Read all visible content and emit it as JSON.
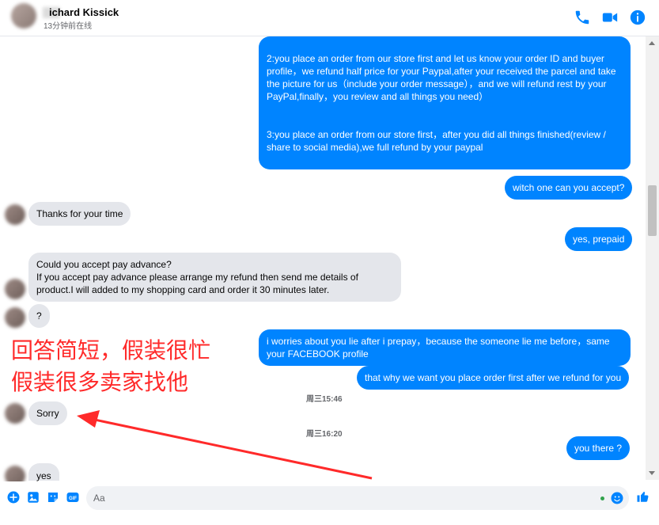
{
  "header": {
    "contact_name": "ichard Kissick",
    "status": "13分钟前在线"
  },
  "icons": {
    "call": "phone-icon",
    "video": "video-icon",
    "info": "info-icon",
    "add": "plus-icon",
    "photo": "photo-icon",
    "sticker": "sticker-icon",
    "gif": "gif-icon",
    "emoji": "emoji-icon",
    "like": "thumbs-up-icon"
  },
  "colors": {
    "accent": "#0084ff",
    "incoming_bubble": "#e4e6eb",
    "annotation": "#ff2a2a"
  },
  "messages": [
    {
      "from": "me",
      "text": "2:you place an order from our store first and let us know your order ID and buyer profile，we refund half price for your Paypal,after your received the parcel and take the picture for us（include your order message），and we will refund rest by your PayPal,finally，you review and all things you need）\n\n\n3:you place an order from our store first，after you did all things finished(review / share to social media),we full refund by your paypal"
    },
    {
      "from": "me",
      "text": "witch one can you accept?"
    },
    {
      "from": "them",
      "text": "Thanks for your time"
    },
    {
      "from": "me",
      "text": "yes, prepaid"
    },
    {
      "from": "them",
      "text": "Could you accept pay advance?\nIf you accept pay advance please arrange my refund then send me details of product.I will added to my shopping card and order it 30 minutes later."
    },
    {
      "from": "them",
      "text": "?"
    },
    {
      "from": "me",
      "text": "i worries about you lie after i prepay，because the someone lie me before，same your FACEBOOK profile"
    },
    {
      "from": "me",
      "text": "that why we want you place order first after we refund for you"
    },
    {
      "from": "them",
      "text": "Sorry"
    },
    {
      "from": "me",
      "text": "you there ?"
    },
    {
      "from": "them",
      "text": "yes"
    }
  ],
  "timestamps": [
    "周三15:46",
    "周三16:20"
  ],
  "annotation": {
    "line1": "回答简短，假装很忙",
    "line2": "假装很多卖家找他"
  },
  "composer": {
    "placeholder": "Aa"
  }
}
